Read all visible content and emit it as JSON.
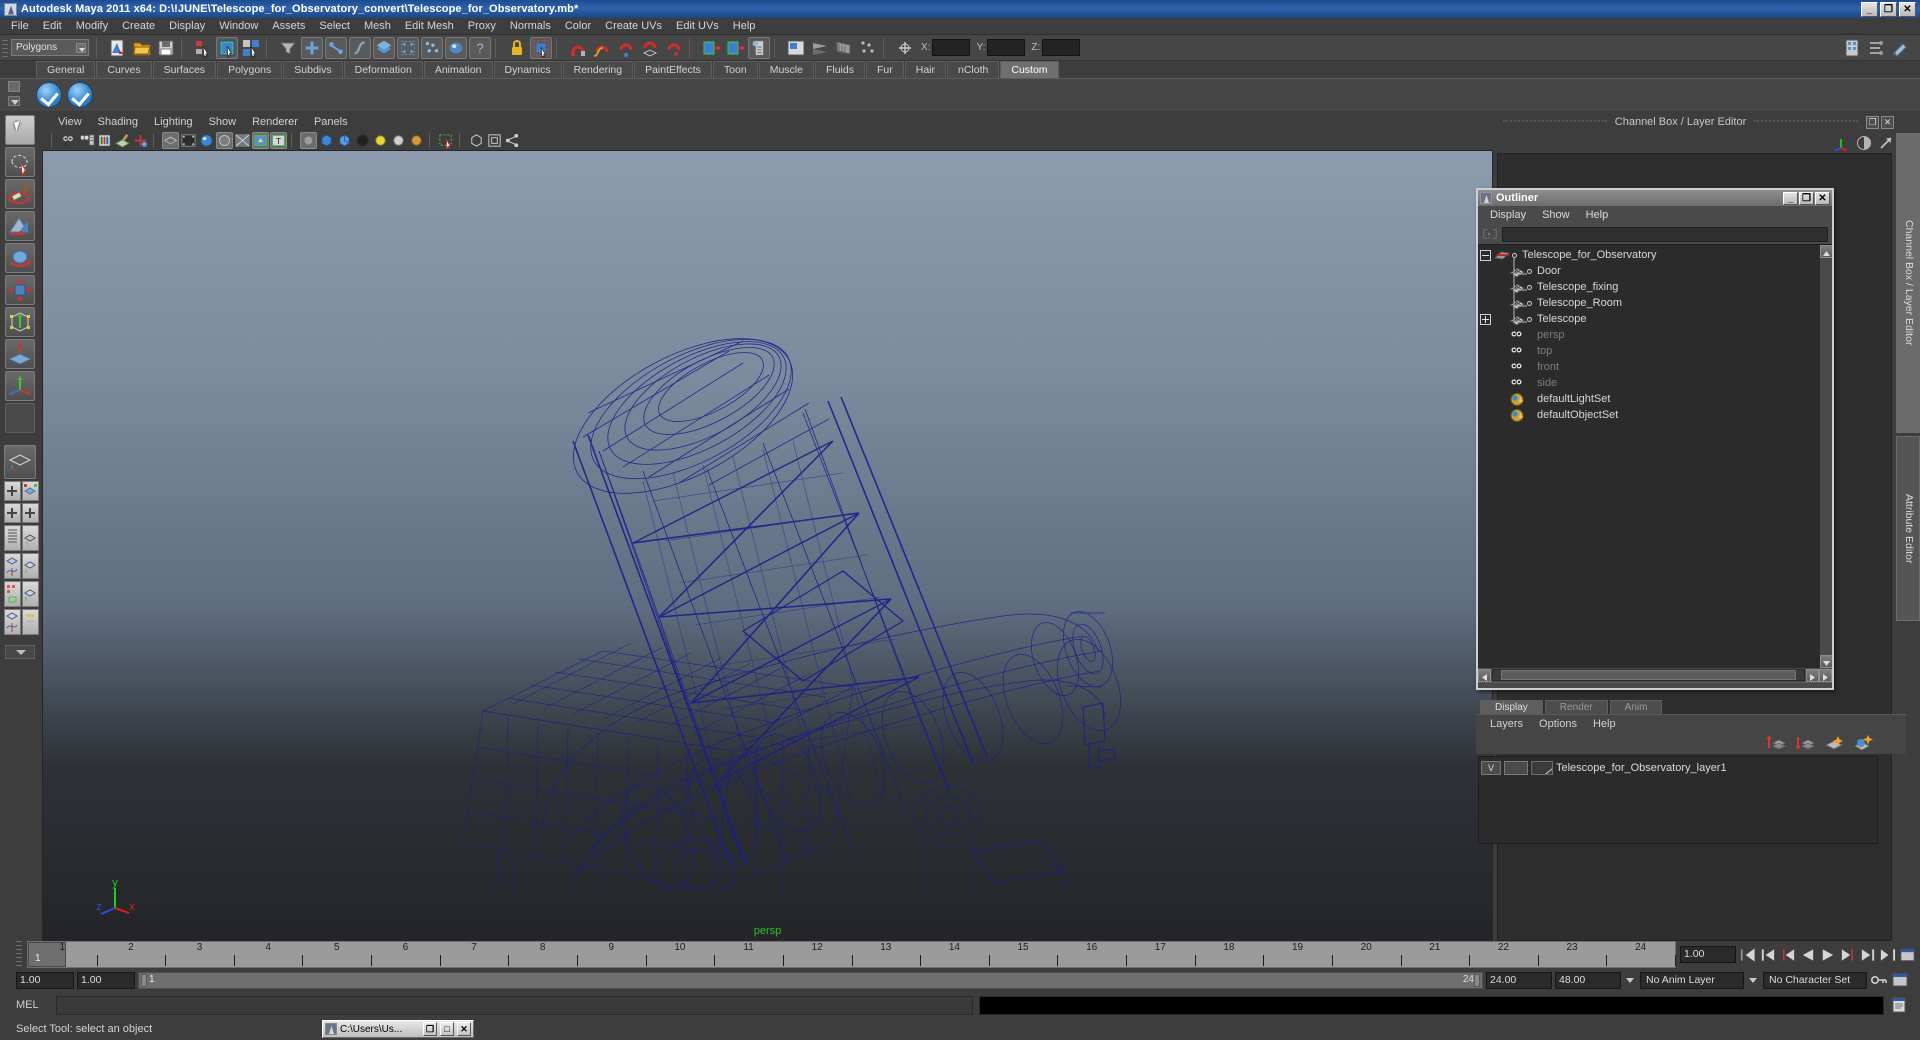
{
  "window": {
    "title": "Autodesk Maya 2011 x64: D:\\!JUNE\\Telescope_for_Observatory_convert\\Telescope_for_Observatory.mb*",
    "minimize": "_",
    "restore": "❐",
    "close": "✕"
  },
  "menubar": {
    "items": [
      "File",
      "Edit",
      "Modify",
      "Create",
      "Display",
      "Window",
      "Assets",
      "Select",
      "Mesh",
      "Edit Mesh",
      "Proxy",
      "Normals",
      "Color",
      "Create UVs",
      "Edit UVs",
      "Help"
    ]
  },
  "toolbar": {
    "mode_select": "Polygons",
    "coord_labels": [
      "X:",
      "Y:",
      "Z:"
    ],
    "coord_values": [
      "",
      "",
      ""
    ]
  },
  "shelf": {
    "tabs": [
      "General",
      "Curves",
      "Surfaces",
      "Polygons",
      "Subdivs",
      "Deformation",
      "Animation",
      "Dynamics",
      "Rendering",
      "PaintEffects",
      "Toon",
      "Muscle",
      "Fluids",
      "Fur",
      "Hair",
      "nCloth",
      "Custom"
    ],
    "active_tab": "Custom",
    "buttons": [
      "check-blue-1",
      "check-blue-2"
    ]
  },
  "toolbox": {
    "items": [
      "select-tool",
      "lasso-select-tool",
      "paint-select-tool",
      "move-tool",
      "rotate-tool",
      "scale-tool",
      "universal-manipulator",
      "soft-modification-tool",
      "show-manipulator-tool",
      "last-tool-blank",
      "single-perspective-view",
      "four-view-layout-a",
      "four-view-layout-b",
      "outliner-persp-layout",
      "persp-graph-layout",
      "hypershade-persp-layout",
      "persp-graph-outliner-layout"
    ]
  },
  "viewport": {
    "menus": [
      "View",
      "Shading",
      "Lighting",
      "Show",
      "Renderer",
      "Panels"
    ],
    "camera_label": "persp",
    "axis": {
      "x": "x",
      "y": "y",
      "z": "z"
    },
    "wireframe_color": "#1b1f8a",
    "background_top": "#8d9bae",
    "background_bottom": "#232528"
  },
  "channel_box": {
    "title": "Channel Box / Layer Editor",
    "restore": "❐",
    "close": "✕"
  },
  "side_tabs": {
    "items": [
      "Channel Box / Layer Editor",
      "Attribute Editor"
    ],
    "active": "Channel Box / Layer Editor"
  },
  "outliner": {
    "title": "Outliner",
    "window_buttons": [
      "_",
      "❐",
      "✕"
    ],
    "menus": [
      "Display",
      "Show",
      "Help"
    ],
    "search_value": "",
    "search_placeholder": "",
    "items": [
      {
        "label": "Telescope_for_Observatory",
        "icon": "transform-root-icon",
        "expander": "minus",
        "depth": 0,
        "dim": false
      },
      {
        "label": "Door",
        "icon": "mesh-icon",
        "expander": "none",
        "depth": 1,
        "dim": false
      },
      {
        "label": "Telescope_fixing",
        "icon": "mesh-icon",
        "expander": "none",
        "depth": 1,
        "dim": false
      },
      {
        "label": "Telescope_Room",
        "icon": "mesh-icon",
        "expander": "none",
        "depth": 1,
        "dim": false
      },
      {
        "label": "Telescope",
        "icon": "mesh-icon",
        "expander": "plus",
        "depth": 1,
        "dim": false
      },
      {
        "label": "persp",
        "icon": "camera-icon",
        "expander": "none",
        "depth": 1,
        "dim": true
      },
      {
        "label": "top",
        "icon": "camera-icon",
        "expander": "none",
        "depth": 1,
        "dim": true
      },
      {
        "label": "front",
        "icon": "camera-icon",
        "expander": "none",
        "depth": 1,
        "dim": true
      },
      {
        "label": "side",
        "icon": "camera-icon",
        "expander": "none",
        "depth": 1,
        "dim": true
      },
      {
        "label": "defaultLightSet",
        "icon": "set-icon",
        "expander": "none",
        "depth": 1,
        "dim": false
      },
      {
        "label": "defaultObjectSet",
        "icon": "set-icon",
        "expander": "none",
        "depth": 1,
        "dim": false
      }
    ]
  },
  "layer_editor": {
    "tabs": [
      "Display",
      "Render",
      "Anim"
    ],
    "active_tab": "Display",
    "menus": [
      "Layers",
      "Options",
      "Help"
    ],
    "icons": [
      "move-layer-up-icon",
      "move-layer-down-icon",
      "new-layer-icon",
      "new-layer-from-selected-icon"
    ],
    "layers": [
      {
        "visibility": "V",
        "display_type": "",
        "name": "Telescope_for_Observatory_layer1"
      }
    ]
  },
  "timeline": {
    "ticks": [
      "1",
      "2",
      "3",
      "4",
      "5",
      "6",
      "7",
      "8",
      "9",
      "10",
      "11",
      "12",
      "13",
      "14",
      "15",
      "16",
      "17",
      "18",
      "19",
      "20",
      "21",
      "22",
      "23",
      "24"
    ],
    "current_frame_label": "1",
    "current_frame_field": "1.00",
    "playback_buttons": [
      "go-to-start",
      "step-back-key",
      "step-back-frame",
      "play-backwards",
      "play-forwards",
      "step-forward-frame",
      "step-forward-key",
      "go-to-end"
    ],
    "range_start": "1.00",
    "range_by": "1.00",
    "range_bar_start": "1",
    "range_bar_end": "24",
    "anim_end": "24.00",
    "playback_end": "48.00",
    "anim_layer": "No Anim Layer",
    "character_set": "No Character Set"
  },
  "command_line": {
    "label": "MEL",
    "input_value": "",
    "output_value": ""
  },
  "status": {
    "help_text": "Select Tool: select an object"
  },
  "taskbar": {
    "item_label": "C:\\Users\\Us...",
    "buttons": [
      "❐",
      "□",
      "✕"
    ]
  }
}
